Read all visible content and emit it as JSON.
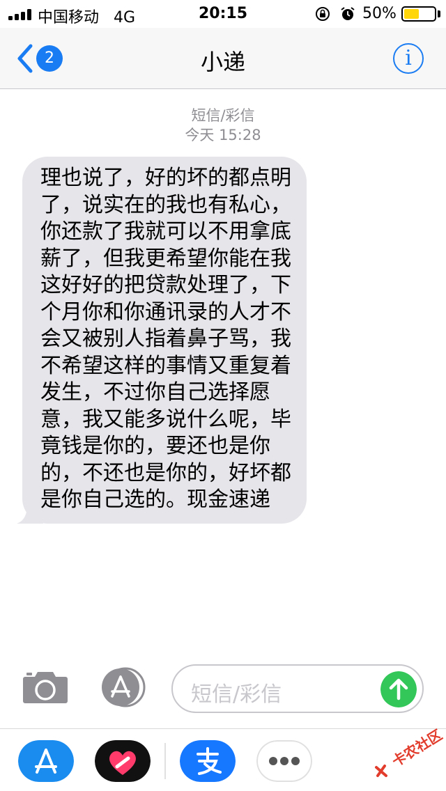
{
  "status_bar": {
    "carrier": "中国移动",
    "network": "4G",
    "time": "20:15",
    "battery_percent": "50%",
    "battery_level": 0.5,
    "signal_bars": 4,
    "icons": [
      "signal-icon",
      "orientation-lock-icon",
      "alarm-icon",
      "battery-icon"
    ]
  },
  "nav": {
    "back_badge": "2",
    "title": "小递",
    "info_label": "i"
  },
  "conversation": {
    "message_type": "短信/彩信",
    "timestamp": "今天 15:28",
    "messages": [
      {
        "direction": "incoming",
        "text": "理也说了，好的坏的都点明了，说实在的我也有私心，你还款了我就可以不用拿底薪了，但我更希望你能在我这好好的把贷款处理了，下个月你和你通讯录的人才不会又被别人指着鼻子骂，我不希望这样的事情又重复着发生，不过你自己选择愿意，我又能多说什么呢，毕竟钱是你的，要还也是你的，不还也是你的，好坏都是你自己选的。现金速递"
      }
    ]
  },
  "input_bar": {
    "placeholder": "短信/彩信",
    "icons": [
      "camera-icon",
      "app-store-icon",
      "send-arrow-icon"
    ]
  },
  "app_drawer": {
    "apps": [
      "app-store-icon",
      "digital-touch-heart-icon",
      "alipay-icon",
      "more-icon"
    ]
  },
  "watermark": {
    "text": "卡农社区"
  },
  "colors": {
    "accent": "#1a7cf2",
    "bubble": "#e5e5ea",
    "send": "#33c759",
    "timestamp": "#8e8e93",
    "watermark": "#e23c2c"
  }
}
